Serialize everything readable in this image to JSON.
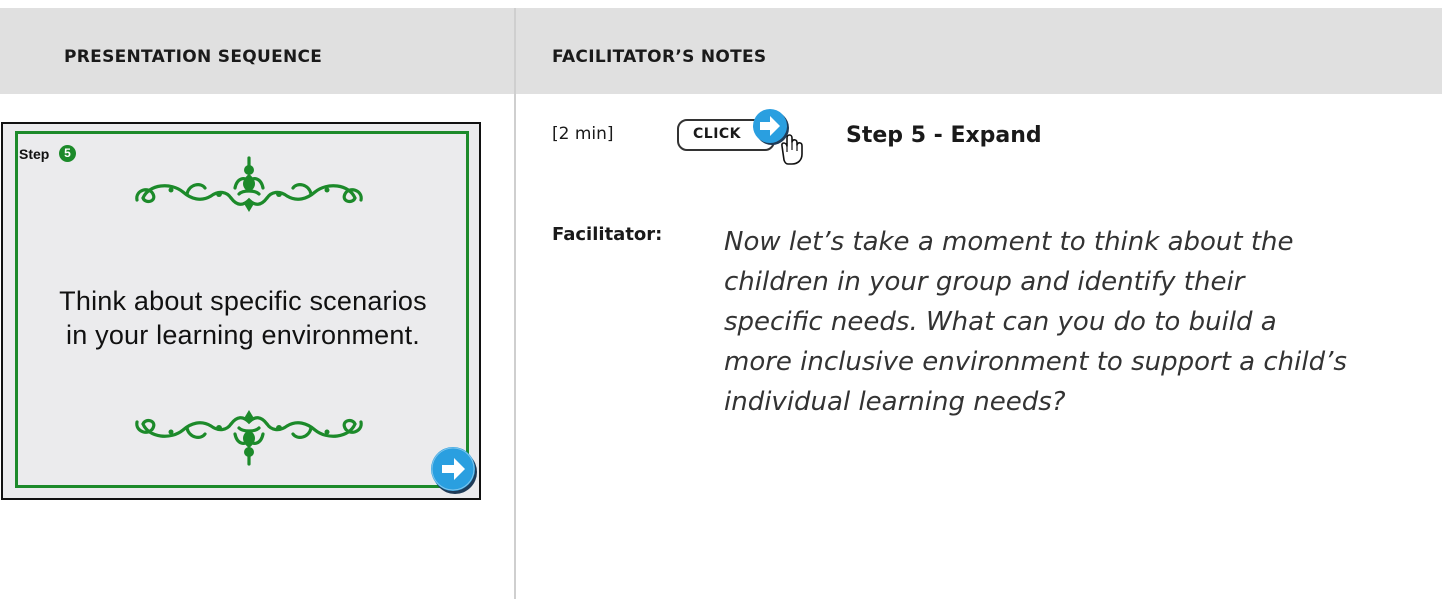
{
  "header": {
    "left_title": "PRESENTATION SEQUENCE",
    "right_title": "FACILITATOR’S NOTES"
  },
  "slide": {
    "step_label": "Step",
    "step_number": "5",
    "text_lines": [
      "Think about specific scenarios",
      "in your learning environment."
    ],
    "accent_color": "#1c8a2a",
    "next_icon": "arrow-right-circle-icon"
  },
  "notes": {
    "time": "[2 min]",
    "click_label": "CLICK",
    "click_icon": "pointer-hand-icon",
    "step_title": "Step 5 - Expand",
    "facilitator_label": "Facilitator:",
    "facilitator_lines": [
      "Now let’s take a moment to think about the",
      "children in your group and identify their",
      "specific needs. What can you do to build a",
      "more inclusive environment to support a child’s",
      "individual learning needs?"
    ]
  }
}
